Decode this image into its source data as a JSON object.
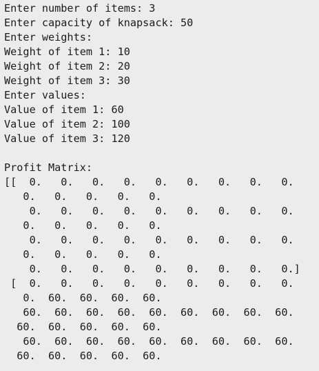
{
  "console": {
    "lines": [
      "Enter number of items: 3",
      "Enter capacity of knapsack: 50",
      "Enter weights:",
      "Weight of item 1: 10",
      "Weight of item 2: 20",
      "Weight of item 3: 30",
      "Enter values:",
      "Value of item 1: 60",
      "Value of item 2: 100",
      "Value of item 3: 120",
      "",
      "Profit Matrix:",
      "[[  0.   0.   0.   0.   0.   0.   0.   0.   0.",
      "   0.   0.   0.   0.   0.",
      "    0.   0.   0.   0.   0.   0.   0.   0.   0.",
      "   0.   0.   0.   0.   0.",
      "    0.   0.   0.   0.   0.   0.   0.   0.   0.",
      "   0.   0.   0.   0.   0.",
      "    0.   0.   0.   0.   0.   0.   0.   0.   0.]",
      " [  0.   0.   0.   0.   0.   0.   0.   0.   0.",
      "   0.  60.  60.  60.  60.",
      "   60.  60.  60.  60.  60.  60.  60.  60.  60.",
      "  60.  60.  60.  60.  60.",
      "   60.  60.  60.  60.  60.  60.  60.  60.  60.",
      "  60.  60.  60.  60.  60."
    ]
  }
}
